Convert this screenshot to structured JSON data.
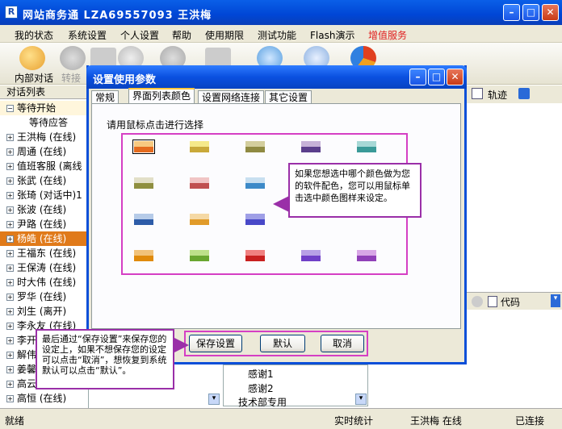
{
  "window": {
    "title": "网站商务通  LZA69557093 王洪梅",
    "icon": "R"
  },
  "menu": [
    "我的状态",
    "系统设置",
    "个人设置",
    "帮助",
    "使用期限",
    "测试功能",
    "Flash演示",
    "增值服务"
  ],
  "toolbar": {
    "internal_chat": "内部对话",
    "transfer": "转接"
  },
  "left_panel": {
    "header": "对话列表",
    "rows": [
      {
        "text": "等待开始",
        "group": true
      },
      {
        "text": "等待应答",
        "indent": true
      },
      {
        "text": "王洪梅  (在线)"
      },
      {
        "text": "周通  (在线)"
      },
      {
        "text": "值班客服  (离线"
      },
      {
        "text": "张武  (在线)"
      },
      {
        "text": "张琦  (对话中)1"
      },
      {
        "text": "张波  (在线)"
      },
      {
        "text": "尹路  (在线)"
      },
      {
        "text": "杨皓  (在线)",
        "selected": true
      },
      {
        "text": "王福东  (在线)"
      },
      {
        "text": "王保涛  (在线)"
      },
      {
        "text": "时大伟  (在线)"
      },
      {
        "text": "罗华  (在线)"
      },
      {
        "text": "刘生  (离开)"
      },
      {
        "text": "李永友  (在线)"
      },
      {
        "text": "李开"
      },
      {
        "text": "解伟"
      },
      {
        "text": "姜馨"
      },
      {
        "text": "高云"
      },
      {
        "text": "高恒  (在线)"
      }
    ]
  },
  "right_panel": {
    "track_label": "轨迹",
    "code_label": "代码"
  },
  "bottom_list": [
    "感谢1",
    "感谢2",
    "技术部专用"
  ],
  "statusbar": {
    "ready": "就绪",
    "stats": "实时统计",
    "user": "王洪梅 在线",
    "connected": "已连接"
  },
  "dialog": {
    "title": "设置使用参数",
    "tabs": [
      "常规",
      "界面列表颜色",
      "设置网络连接",
      "其它设置"
    ],
    "prompt": "请用鼠标点击进行选择",
    "save": "保存设置",
    "default": "默认",
    "cancel": "取消"
  },
  "callouts": {
    "color_tip": "如果您想选中哪个颜色做为您的软件配色，您可以用鼠标单击选中颜色图样来设定。",
    "save_tip": "最后通过“保存设置”来保存您的设定上，如果不想保存您的设定可以点击“取消”，想恢复到系统默认可以点击“默认”。"
  },
  "swatches": [
    [
      "#f7c980",
      "#e46b1e"
    ],
    [
      "#f5e98a",
      "#c9a93a"
    ],
    [
      "#d3ce9d",
      "#8f8a42"
    ],
    [
      "#c6b2d8",
      "#5b3f8c"
    ],
    [
      "#a7d8d6",
      "#3a9a98"
    ],
    [
      "#e2dfc8",
      "#8f8f40"
    ],
    [
      "#f1c5c5",
      "#c05050"
    ],
    [
      "#c8dff0",
      "#3d8ac8"
    ],
    null,
    null,
    [
      "#b6cbe8",
      "#2d5ca8"
    ],
    [
      "#f5d9a5",
      "#e19b2a"
    ],
    [
      "#9f9fe6",
      "#4848c8"
    ],
    null,
    null,
    [
      "#f1c27a",
      "#e08a0c"
    ],
    [
      "#bde08a",
      "#69a630"
    ],
    [
      "#f08080",
      "#c82020"
    ],
    [
      "#b8a0e6",
      "#7040c8"
    ],
    [
      "#d8a6e6",
      "#9040b8"
    ]
  ],
  "colors": {
    "accent_orange": "#e07a1a",
    "highlight_pink": "#d53fc4",
    "callout_purple": "#9a2fa8",
    "xp_blue": "#0a50e0"
  }
}
